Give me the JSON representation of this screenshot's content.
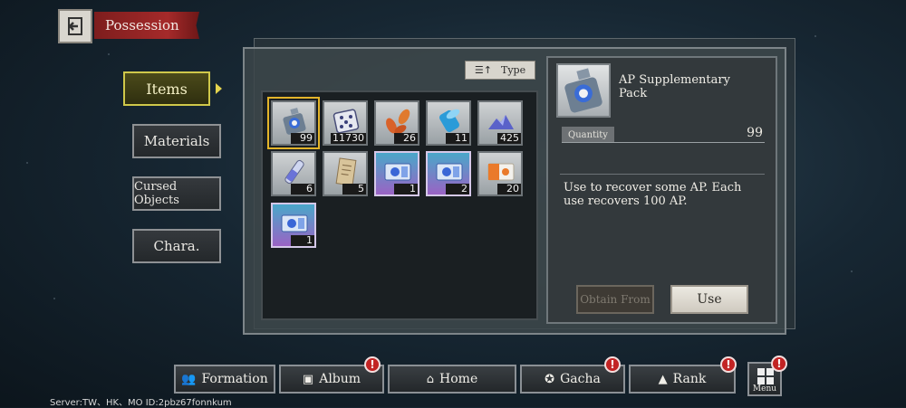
{
  "header": {
    "title": "Possession"
  },
  "sidebar": {
    "tabs": [
      {
        "label": "Items"
      },
      {
        "label": "Materials"
      },
      {
        "label": "Cursed Objects"
      },
      {
        "label": "Chara."
      }
    ]
  },
  "inventory": {
    "sort_label": "Type",
    "items": [
      {
        "icon": "ap-pack-icon",
        "qty": "99"
      },
      {
        "icon": "dice-icon",
        "qty": "11730"
      },
      {
        "icon": "leaves-icon",
        "qty": "26"
      },
      {
        "icon": "blue-cylinder-icon",
        "qty": "11"
      },
      {
        "icon": "crystal-pile-icon",
        "qty": "425"
      },
      {
        "icon": "vial-icon",
        "qty": "6"
      },
      {
        "icon": "scroll-icon",
        "qty": "5"
      },
      {
        "icon": "ticket-icon",
        "qty": "1"
      },
      {
        "icon": "ticket-icon",
        "qty": "2"
      },
      {
        "icon": "orange-ticket-icon",
        "qty": "20"
      },
      {
        "icon": "ticket-icon",
        "qty": "1"
      }
    ]
  },
  "detail": {
    "name": "AP Supplementary Pack",
    "quantity_label": "Quantity",
    "quantity": "99",
    "description": "Use to recover some AP. Each use recovers 100 AP.",
    "obtain_label": "Obtain From",
    "use_label": "Use"
  },
  "nav": {
    "formation": "Formation",
    "album": "Album",
    "home": "Home",
    "gacha": "Gacha",
    "rank": "Rank",
    "menu": "Menu",
    "badge": "!"
  },
  "footer": {
    "server": "Server:TW、HK、MO ID:2pbz67fonnkum"
  }
}
